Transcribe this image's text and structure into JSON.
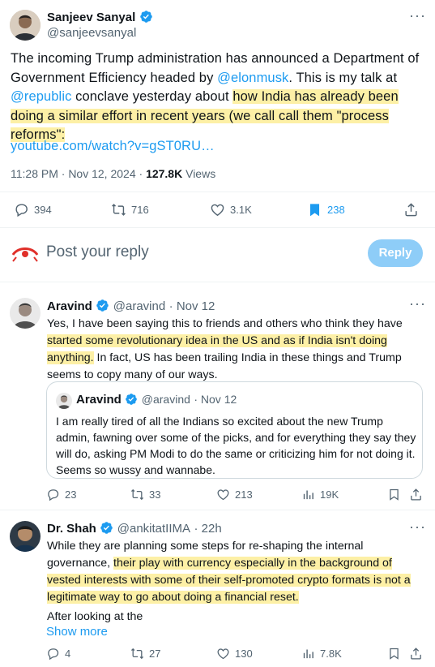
{
  "main_tweet": {
    "author_name": "Sanjeev Sanyal",
    "author_handle": "@sanjeevsanyal",
    "text_part1": "The incoming Trump administration has announced a Department of Government Efficiency headed by ",
    "mention1": "@elonmusk",
    "text_part2": ". This is my talk at ",
    "mention2": "@republic",
    "text_part3": " conclave yesterday about ",
    "text_highlight": "how India has already been doing a similar effort in recent years (we call call them \"process reforms\":",
    "link": "youtube.com/watch?v=gST0RU…",
    "time": "11:28 PM · Nov 12, 2024",
    "dot": " · ",
    "views_count": "127.8K",
    "views_label": "Views",
    "stats": {
      "replies": "394",
      "reposts": "716",
      "likes": "3.1K",
      "bookmarks": "238"
    }
  },
  "compose": {
    "placeholder": "Post your reply",
    "button": "Reply"
  },
  "replies": [
    {
      "author_name": "Aravind",
      "author_handle": "@aravind",
      "date": "· Nov 12",
      "text_part1": "Yes, I have been saying this to friends and others who think they have ",
      "text_highlight": "started some revolutionary idea in the US and as if India isn't doing anything.",
      "text_part2": " In fact, US has been trailing India in these things and Trump seems to copy many of our ways.",
      "quote": {
        "author_name": "Aravind",
        "author_handle": "@aravind",
        "date": "· Nov 12",
        "text": "I am really tired of all the Indians so excited about the new Trump admin, fawning over some of the picks, and for everything they say they will do, asking PM Modi to do the same or criticizing him for not doing it. Seems so wussy and wannabe."
      },
      "stats": {
        "replies": "23",
        "reposts": "33",
        "likes": "213",
        "views": "19K"
      }
    },
    {
      "author_name": "Dr. Shah",
      "author_handle": "@ankitatIIMA",
      "date": "· 22h",
      "text_part1": "While they are planning some steps for re-shaping the internal governance, ",
      "text_highlight": "their play with currency especially in the background of vested interests with some of their self-promoted crypto formats is not a legitimate way to go about doing a financial reset.",
      "text_part2": "After looking at the",
      "show_more": "Show more",
      "stats": {
        "replies": "4",
        "reposts": "27",
        "likes": "130",
        "views": "7.8K"
      }
    }
  ],
  "colors": {
    "accent": "#1d9bf0",
    "highlight": "#fdf0a6",
    "muted": "#536471"
  }
}
